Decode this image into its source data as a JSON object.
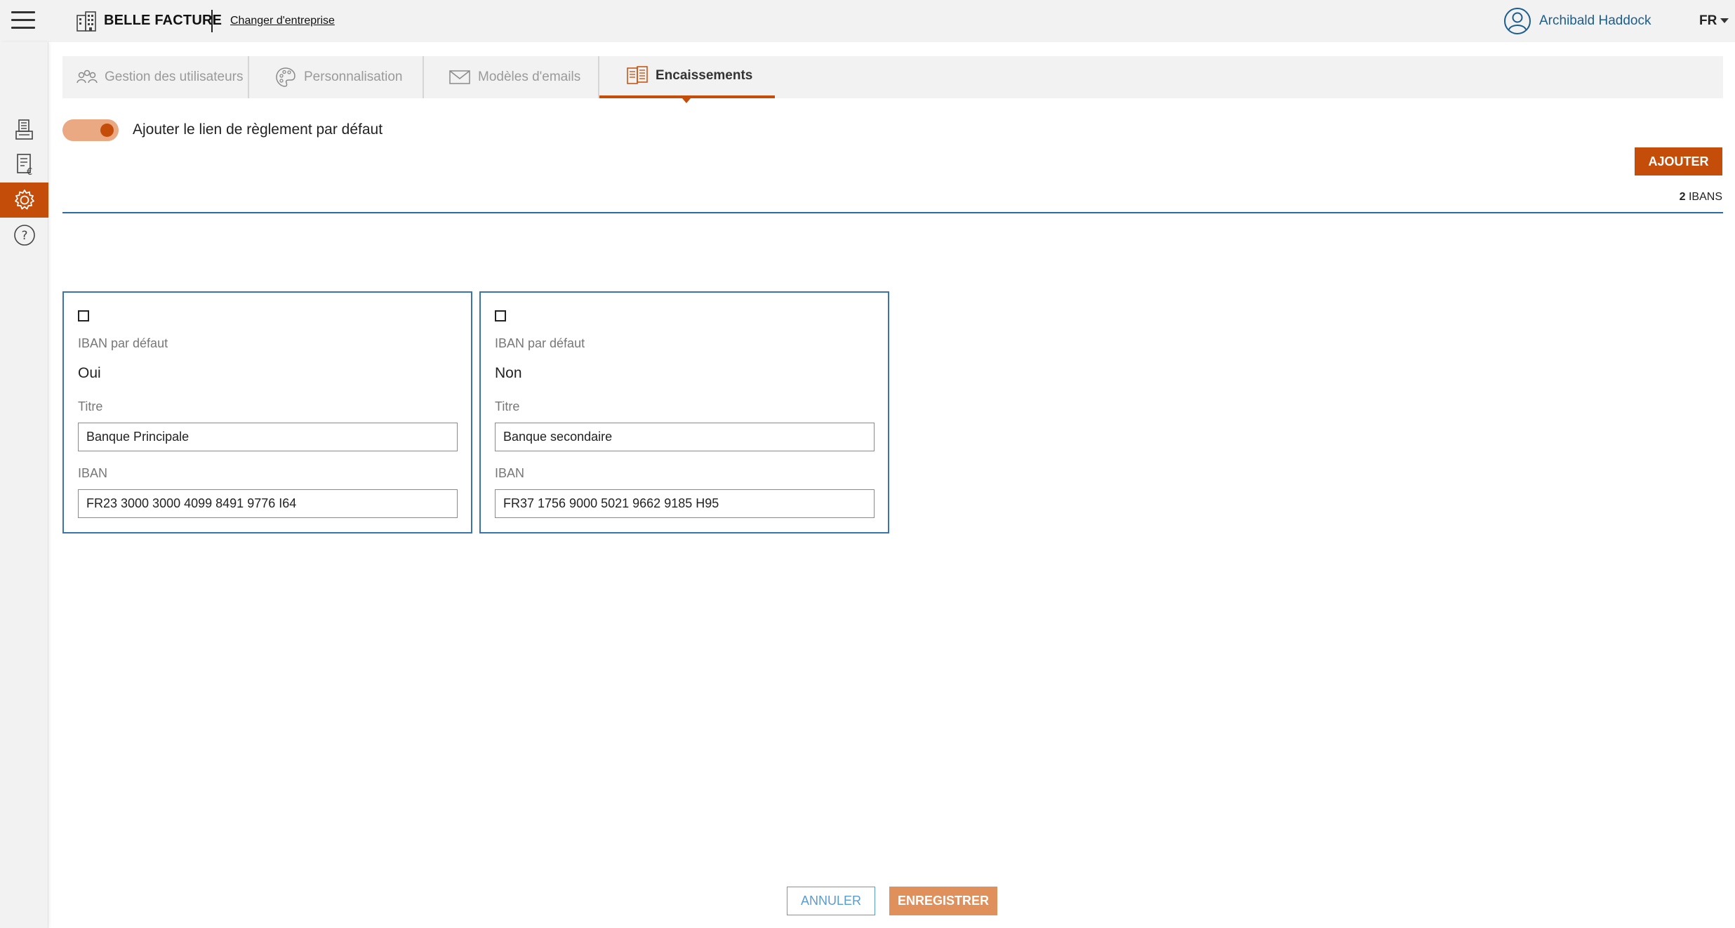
{
  "header": {
    "company_name": "BELLE FACTURE",
    "change_company": "Changer d'entreprise",
    "user_name": "Archibald Haddock",
    "language": "FR"
  },
  "sidebar": {
    "items": [
      {
        "icon": "documents-icon",
        "active": false
      },
      {
        "icon": "invoice-euro-icon",
        "active": false
      },
      {
        "icon": "gear-icon",
        "active": true
      },
      {
        "icon": "help-icon",
        "active": false
      }
    ]
  },
  "tabs": [
    {
      "label": "Gestion des utilisateurs",
      "icon": "users-icon",
      "active": false
    },
    {
      "label": "Personnalisation",
      "icon": "palette-icon",
      "active": false
    },
    {
      "label": "Modèles d'emails",
      "icon": "envelope-icon",
      "active": false
    },
    {
      "label": "Encaissements",
      "icon": "payments-icon",
      "active": true
    }
  ],
  "settings": {
    "toggle_label": "Ajouter le lien de règlement par défaut",
    "toggle_on": true
  },
  "toolbar": {
    "add_label": "AJOUTER",
    "count": "2",
    "count_unit": "IBANS"
  },
  "cards": [
    {
      "default_label": "IBAN par défaut",
      "default_value": "Oui",
      "title_label": "Titre",
      "title_value": "Banque Principale",
      "iban_label": "IBAN",
      "iban_value": "FR23 3000 3000 4099 8491 9776 I64"
    },
    {
      "default_label": "IBAN par défaut",
      "default_value": "Non",
      "title_label": "Titre",
      "title_value": "Banque secondaire",
      "iban_label": "IBAN",
      "iban_value": "FR37 1756 9000 5021 9662 9185 H95"
    }
  ],
  "footer": {
    "cancel_label": "ANNULER",
    "save_label": "ENREGISTRER"
  },
  "colors": {
    "accent": "#c44d0a",
    "accent_light": "#eaa883",
    "link_blue": "#1d5d8c",
    "card_border": "#3a73b0"
  }
}
